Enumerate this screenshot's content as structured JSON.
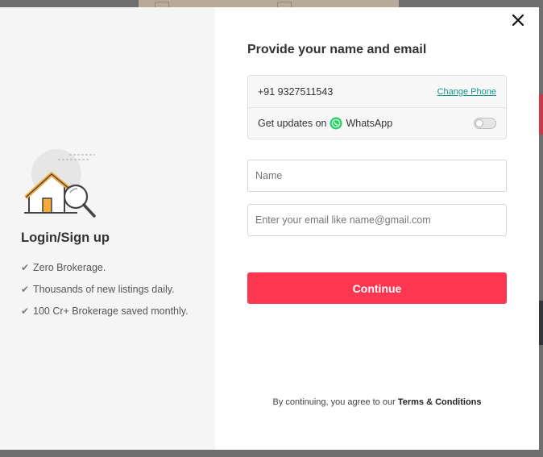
{
  "modal": {
    "left": {
      "title": "Login/Sign up",
      "benefits": [
        "Zero Brokerage.",
        "Thousands of new listings daily.",
        "100 Cr+ Brokerage saved monthly."
      ]
    },
    "right": {
      "heading": "Provide your name and email",
      "phone": {
        "number": "+91 9327511543",
        "change_label": "Change Phone"
      },
      "whatsapp": {
        "label_prefix": "Get updates on",
        "label_brand": "WhatsApp",
        "enabled": false
      },
      "name_field": {
        "placeholder": "Name",
        "value": ""
      },
      "email_field": {
        "placeholder": "Enter your email like name@gmail.com",
        "value": ""
      },
      "continue_label": "Continue",
      "terms_prefix": "By continuing, you agree to our",
      "terms_link": "Terms & Conditions"
    }
  },
  "colors": {
    "accent": "#fd3752",
    "link": "#15968b",
    "whatsapp": "#25d366",
    "house_roof": "#f6a93b"
  },
  "icons": [
    "house-search-illustration",
    "check-icon",
    "whatsapp-icon",
    "toggle-switch",
    "close-icon"
  ]
}
